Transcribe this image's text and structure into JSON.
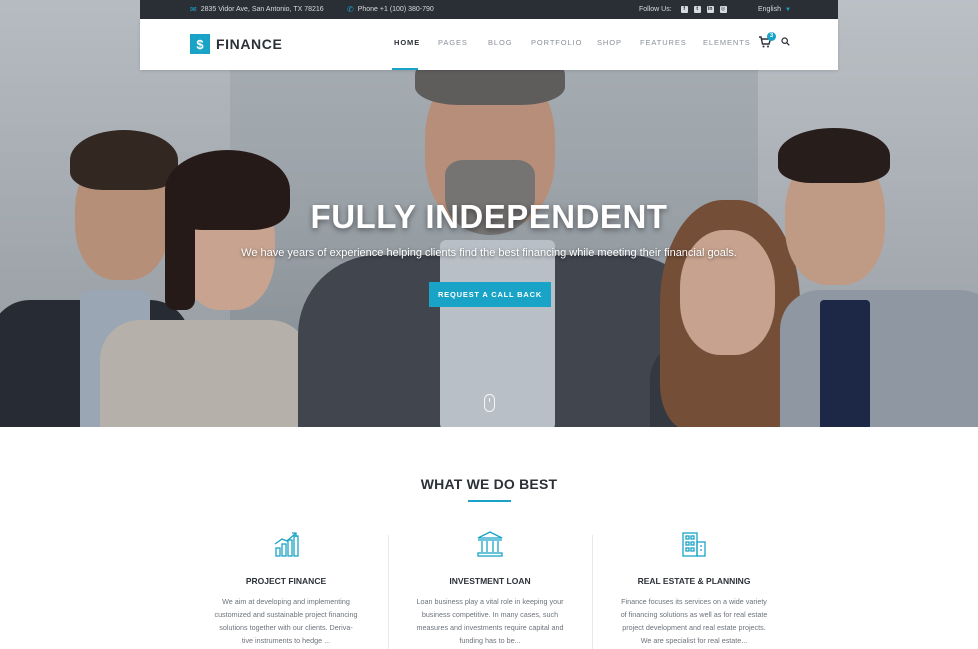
{
  "topbar": {
    "address": "2835 Vidor Ave, San Antonio, TX 78216",
    "phone": "Phone +1 (100) 380-790",
    "follow_label": "Follow Us:",
    "social_icons": [
      "facebook-icon",
      "twitter-icon",
      "linkedin-icon",
      "instagram-icon"
    ],
    "language": "English"
  },
  "nav": {
    "logo_text": "FINANCE",
    "items": [
      {
        "label": "HOME",
        "active": true
      },
      {
        "label": "PAGES"
      },
      {
        "label": "BLOG"
      },
      {
        "label": "PORTFOLIO"
      },
      {
        "label": "SHOP"
      },
      {
        "label": "FEATURES"
      },
      {
        "label": "ELEMENTS"
      }
    ],
    "cart_count": "3"
  },
  "hero": {
    "title": "FULLY INDEPENDENT",
    "subtitle": "We have years of experience helping clients find the best financing while meeting their financial goals.",
    "button_label": "REQUEST A CALL BACK"
  },
  "services": {
    "title": "WHAT WE DO BEST",
    "items": [
      {
        "icon": "bar-chart-icon",
        "name": "PROJECT FINANCE",
        "desc_lines": [
          "We aim at developing and implementing",
          "customized and sustainable project financing",
          "solutions together with our clients. Deriva-",
          "tive instruments to hedge ..."
        ]
      },
      {
        "icon": "bank-icon",
        "name": "INVESTMENT LOAN",
        "desc_lines": [
          "Loan business play a vital role in keeping your",
          "business competitive. In many cases, such",
          "measures and investments require capital and",
          "funding has to be..."
        ]
      },
      {
        "icon": "building-icon",
        "name": "REAL ESTATE & PLANNING",
        "desc_lines": [
          "Finance focuses its services on a wide variety",
          "of financing solutions as well as for real estate",
          "project development and real estate projects.",
          "We are specialist for real estate..."
        ]
      }
    ]
  },
  "colors": {
    "accent": "#19a3c7",
    "topbar_bg": "#2a2f36",
    "heading": "#2c3138"
  }
}
